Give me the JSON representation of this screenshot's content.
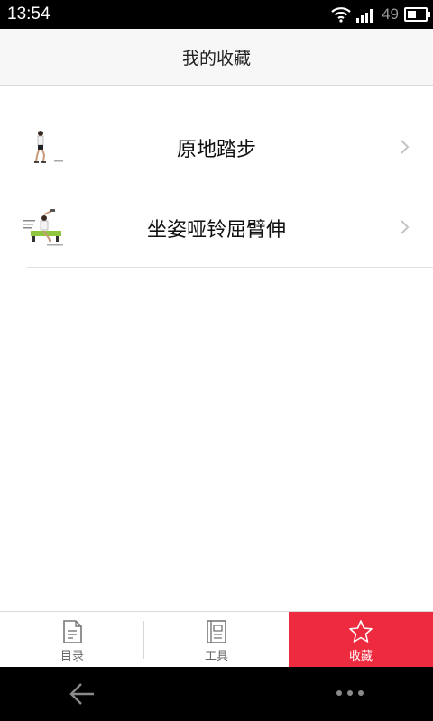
{
  "status": {
    "time": "13:54",
    "battery": "49",
    "battery_level": 0.49
  },
  "header": {
    "title": "我的收藏"
  },
  "favorites": [
    {
      "label": "原地踏步",
      "thumbnail_icon": "stepping-exercise-thumbnail"
    },
    {
      "label": "坐姿哑铃屈臂伸",
      "thumbnail_icon": "seated-dumbbell-extension-thumbnail"
    }
  ],
  "tabs": [
    {
      "label": "目录",
      "icon": "document-icon",
      "active": false
    },
    {
      "label": "工具",
      "icon": "book-icon",
      "active": false
    },
    {
      "label": "收藏",
      "icon": "star-icon",
      "active": true
    }
  ],
  "colors": {
    "accent": "#ee2a3f",
    "header_bg": "#f7f7f7"
  }
}
